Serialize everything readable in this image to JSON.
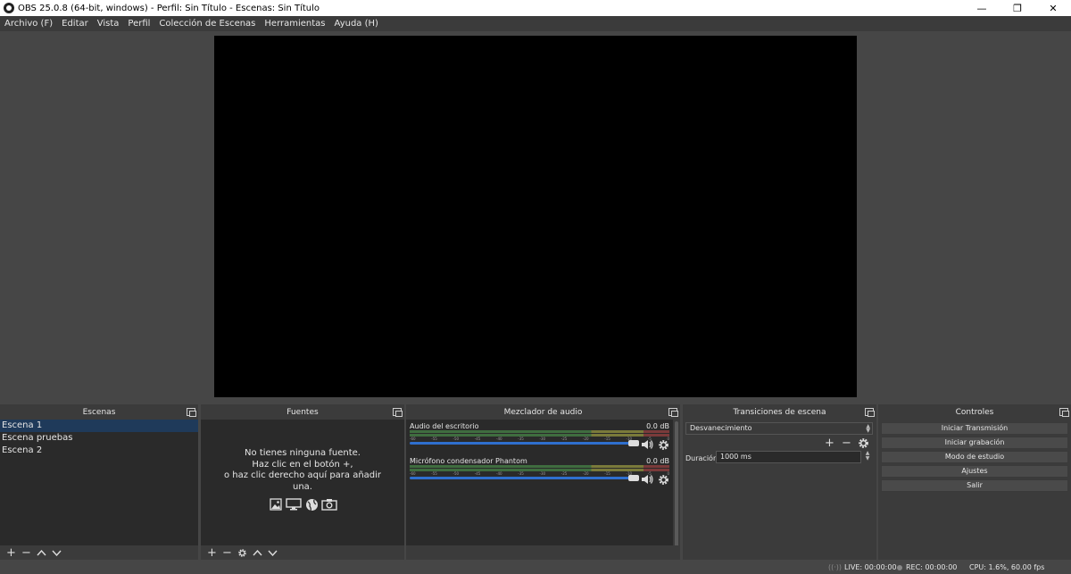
{
  "window": {
    "title": "OBS 25.0.8 (64-bit, windows) - Perfil: Sin Título - Escenas: Sin Título",
    "minimize": "—",
    "restore": "❐",
    "close": "✕"
  },
  "menu": [
    "Archivo (F)",
    "Editar",
    "Vista",
    "Perfil",
    "Colección de Escenas",
    "Herramientas",
    "Ayuda (H)"
  ],
  "scenes": {
    "title": "Escenas",
    "items": [
      "Escena 1",
      "Escena pruebas",
      "Escena 2"
    ],
    "selected_index": 0
  },
  "sources": {
    "title": "Fuentes",
    "empty_lines": [
      "No tienes ninguna fuente.",
      "Haz clic en el botón +,",
      "o haz clic derecho aquí para añadir",
      "una."
    ]
  },
  "mixer": {
    "title": "Mezclador de audio",
    "ticks": [
      "-60",
      "-55",
      "-50",
      "-45",
      "-40",
      "-35",
      "-30",
      "-25",
      "-20",
      "-15",
      "-10",
      "-5",
      "0"
    ],
    "channels": [
      {
        "name": "Audio del escritorio",
        "db": "0.0 dB",
        "volume": 1.0
      },
      {
        "name": "Micrófono condensador Phantom",
        "db": "0.0 dB",
        "volume": 1.0
      }
    ]
  },
  "transitions": {
    "title": "Transiciones de escena",
    "selected": "Desvanecimiento",
    "duration_label": "Duración",
    "duration_value": "1000 ms"
  },
  "controls": {
    "title": "Controles",
    "buttons": [
      "Iniciar Transmisión",
      "Iniciar grabación",
      "Modo de estudio",
      "Ajustes",
      "Salir"
    ]
  },
  "status": {
    "live": "LIVE: 00:00:00",
    "rec": "REC: 00:00:00",
    "cpu": "CPU: 1.6%, 60.00 fps"
  },
  "colors": {
    "accent": "#2f6fce",
    "panel": "#3b3b3b",
    "panel_dark": "#2a2a2a",
    "background": "#464646"
  }
}
